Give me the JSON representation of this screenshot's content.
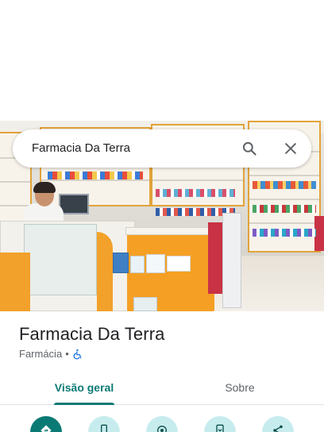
{
  "search": {
    "query": "Farmacia Da Terra"
  },
  "place": {
    "title": "Farmacia Da Terra",
    "category": "Farmácia",
    "separator": "•"
  },
  "tabs": [
    {
      "label": "Visão geral",
      "selected": true
    },
    {
      "label": "Sobre",
      "selected": false
    }
  ],
  "actions": [
    {
      "icon": "directions-icon"
    },
    {
      "icon": "phone-icon"
    },
    {
      "icon": "location-icon"
    },
    {
      "icon": "save-icon"
    },
    {
      "icon": "share-icon"
    }
  ],
  "colors": {
    "accent": "#0b7a75",
    "accent_light": "#c7ecee",
    "text_primary": "#202124",
    "text_secondary": "#5f6368"
  }
}
